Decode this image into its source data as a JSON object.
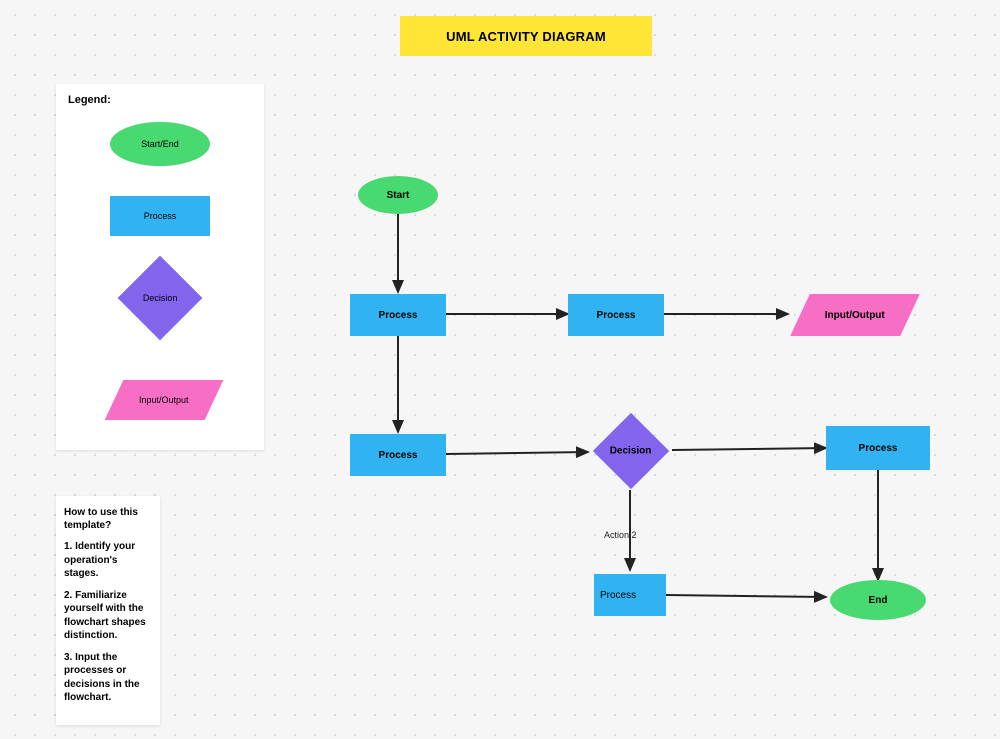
{
  "title": "UML ACTIVITY DIAGRAM",
  "legend": {
    "title": "Legend:",
    "items": {
      "start_end": "Start/End",
      "process": "Process",
      "decision": "Decision",
      "io": "Input/Output"
    }
  },
  "howto": {
    "title": "How to use this template?",
    "steps": [
      "1. Identify your operation's stages.",
      "2. Familiarize yourself with the flowchart shapes distinction.",
      "3. Input the processes or decisions in the flowchart."
    ]
  },
  "nodes": {
    "start": "Start",
    "p1": "Process",
    "p2": "Process",
    "io1": "Input/Output",
    "p3": "Process",
    "decision": "Decision",
    "p4": "Process",
    "p5": "Process",
    "end": "End"
  },
  "edges": {
    "action2_label": "Action 2"
  },
  "chart_data": {
    "type": "flowchart",
    "title": "UML ACTIVITY DIAGRAM",
    "nodes": [
      {
        "id": "start",
        "type": "start",
        "label": "Start"
      },
      {
        "id": "p1",
        "type": "process",
        "label": "Process"
      },
      {
        "id": "p2",
        "type": "process",
        "label": "Process"
      },
      {
        "id": "io1",
        "type": "io",
        "label": "Input/Output"
      },
      {
        "id": "p3",
        "type": "process",
        "label": "Process"
      },
      {
        "id": "decision",
        "type": "decision",
        "label": "Decision"
      },
      {
        "id": "p4",
        "type": "process",
        "label": "Process"
      },
      {
        "id": "p5",
        "type": "process",
        "label": "Process"
      },
      {
        "id": "end",
        "type": "end",
        "label": "End"
      }
    ],
    "edges": [
      {
        "from": "start",
        "to": "p1"
      },
      {
        "from": "p1",
        "to": "p2"
      },
      {
        "from": "p2",
        "to": "io1"
      },
      {
        "from": "p1",
        "to": "p3"
      },
      {
        "from": "p3",
        "to": "decision"
      },
      {
        "from": "decision",
        "to": "p4"
      },
      {
        "from": "decision",
        "to": "p5",
        "label": "Action 2"
      },
      {
        "from": "p4",
        "to": "end"
      },
      {
        "from": "p5",
        "to": "end"
      }
    ]
  }
}
